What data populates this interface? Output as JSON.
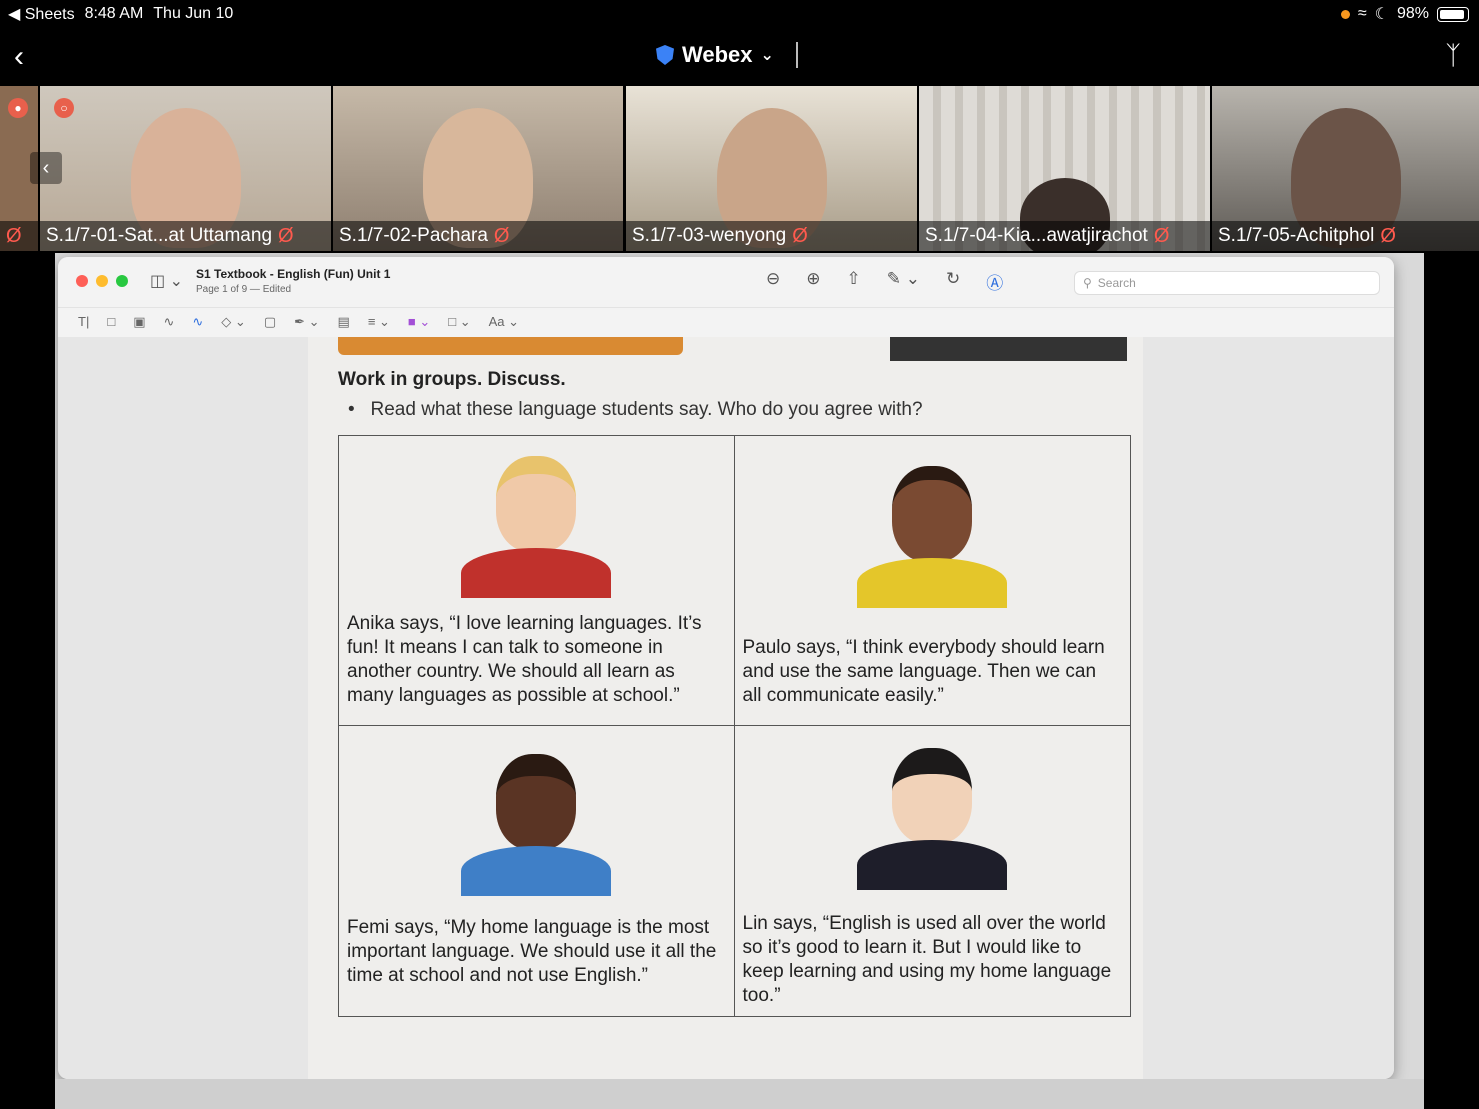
{
  "status_bar": {
    "back_app": "◀ Sheets",
    "time": "8:48 AM",
    "date": "Thu Jun 10",
    "battery": "98%"
  },
  "header": {
    "title": "Webex"
  },
  "participants": [
    {
      "name": "S.1/7-01-Sat...at Uttamang"
    },
    {
      "name": "S.1/7-02-Pachara"
    },
    {
      "name": "S.1/7-03-wenyong"
    },
    {
      "name": "S.1/7-04-Kia...awatjirachot"
    },
    {
      "name": "S.1/7-05-Achitphol"
    }
  ],
  "preview": {
    "doc_title": "S1 Textbook - English (Fun) Unit 1",
    "doc_subtitle": "Page 1 of 9 — Edited",
    "search_placeholder": "Search"
  },
  "page": {
    "heading": "Work in groups. Discuss.",
    "bullet": "Read what these language students say. Who do you agree with?",
    "quotes": [
      {
        "text": "Anika says, “I love learning languages. It’s fun! It means I can talk to someone in another country. We should all learn as many languages as possible at school.”"
      },
      {
        "text": "Paulo says, “I think everybody should learn and use the same language. Then we can all communicate easily.”"
      },
      {
        "text": "Femi says, “My home language is the most important language. We should use it all the time at school and not use English.”"
      },
      {
        "text": "Lin says, “English is used all over the world so it’s good to learn it. But I would like to keep learning and using my home language too.”"
      }
    ]
  },
  "colors": {
    "mute_red": "#ff5a4e",
    "webex_blue": "#3b82f6",
    "banner_orange": "#d98a32"
  }
}
